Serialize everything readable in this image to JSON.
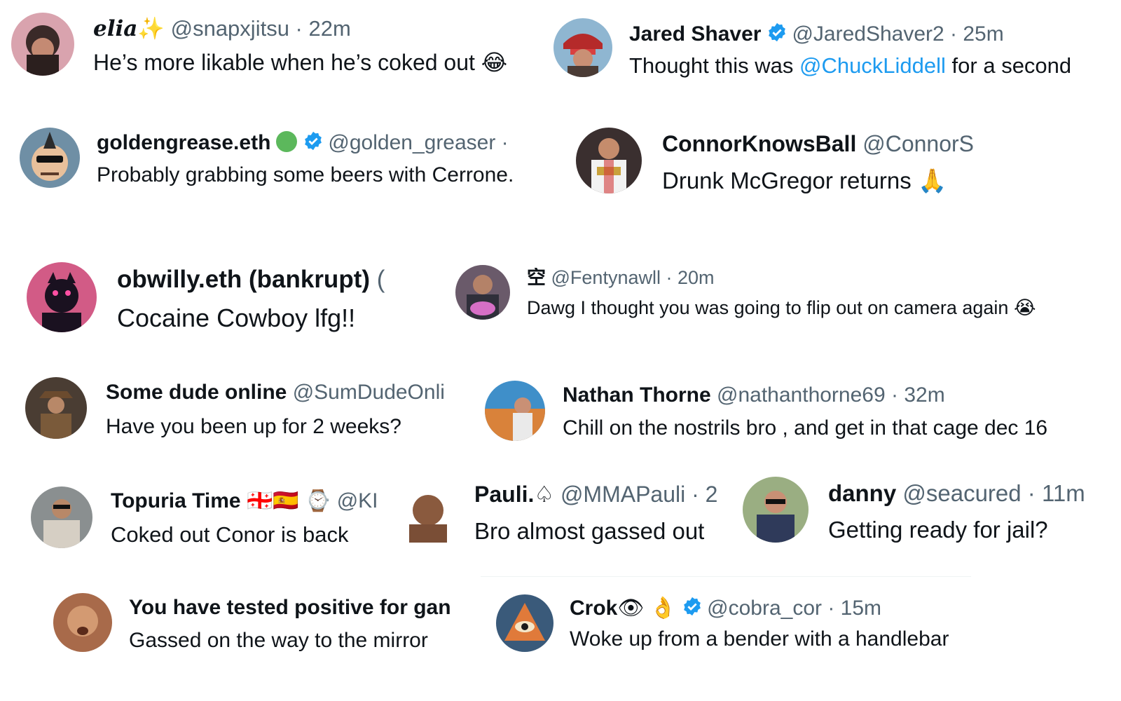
{
  "accent_link_color": "#1d9bf0",
  "verified_color": "#1d9bf0",
  "tweets": [
    {
      "name": "elia",
      "handle": "@snapxjitsu · 22m",
      "text": "He’s more likable when he’s coked out",
      "emoji": "😂",
      "name_emoji": "✨"
    },
    {
      "name": "Jared Shaver",
      "handle": "@JaredShaver2 · 25m",
      "text_pre": "Thought this was ",
      "mention": "@ChuckLiddell",
      "text_post": " for a second"
    },
    {
      "name": "goldengrease.eth",
      "handle": "@golden_greaser ·",
      "text": "Probably grabbing some beers with Cerrone."
    },
    {
      "name": "ConnorKnowsBall",
      "handle": "@ConnorS",
      "text": "Drunk McGregor returns",
      "emoji": "🙏"
    },
    {
      "name": "obwilly.eth (bankrupt)",
      "handle": "(",
      "text": "Cocaine Cowboy lfg!!"
    },
    {
      "name": "空",
      "handle": "@Fentynawll · 20m",
      "text": "Dawg I thought you was going to flip out on camera again",
      "emoji": "😭"
    },
    {
      "name": "Some dude online",
      "handle": "@SumDudeOnli",
      "text": "Have you been up for 2 weeks?"
    },
    {
      "name": "Nathan Thorne",
      "handle": "@nathanthorne69 · 32m",
      "text": "Chill on the nostrils bro , and get in that cage dec 16"
    },
    {
      "name": "Topuria Time",
      "name_emoji": "🇬🇪🇪🇸 ⌚",
      "handle": "@KI",
      "text": "Coked out Conor is back"
    },
    {
      "name": "Pauli.",
      "name_emoji": "♤",
      "handle": "@MMAPauli · 2",
      "text": "Bro almost gassed out"
    },
    {
      "name": "danny",
      "handle": "@seacured · 11m",
      "text": "Getting ready for jail?"
    },
    {
      "name": "You have tested positive for gan",
      "handle": "",
      "text": "Gassed on the way to the mirror"
    },
    {
      "name": "Crok",
      "name_emoji": "👁 👌",
      "handle": "@cobra_cor · 15m",
      "text": "Woke up from a bender with a handlebar"
    }
  ]
}
